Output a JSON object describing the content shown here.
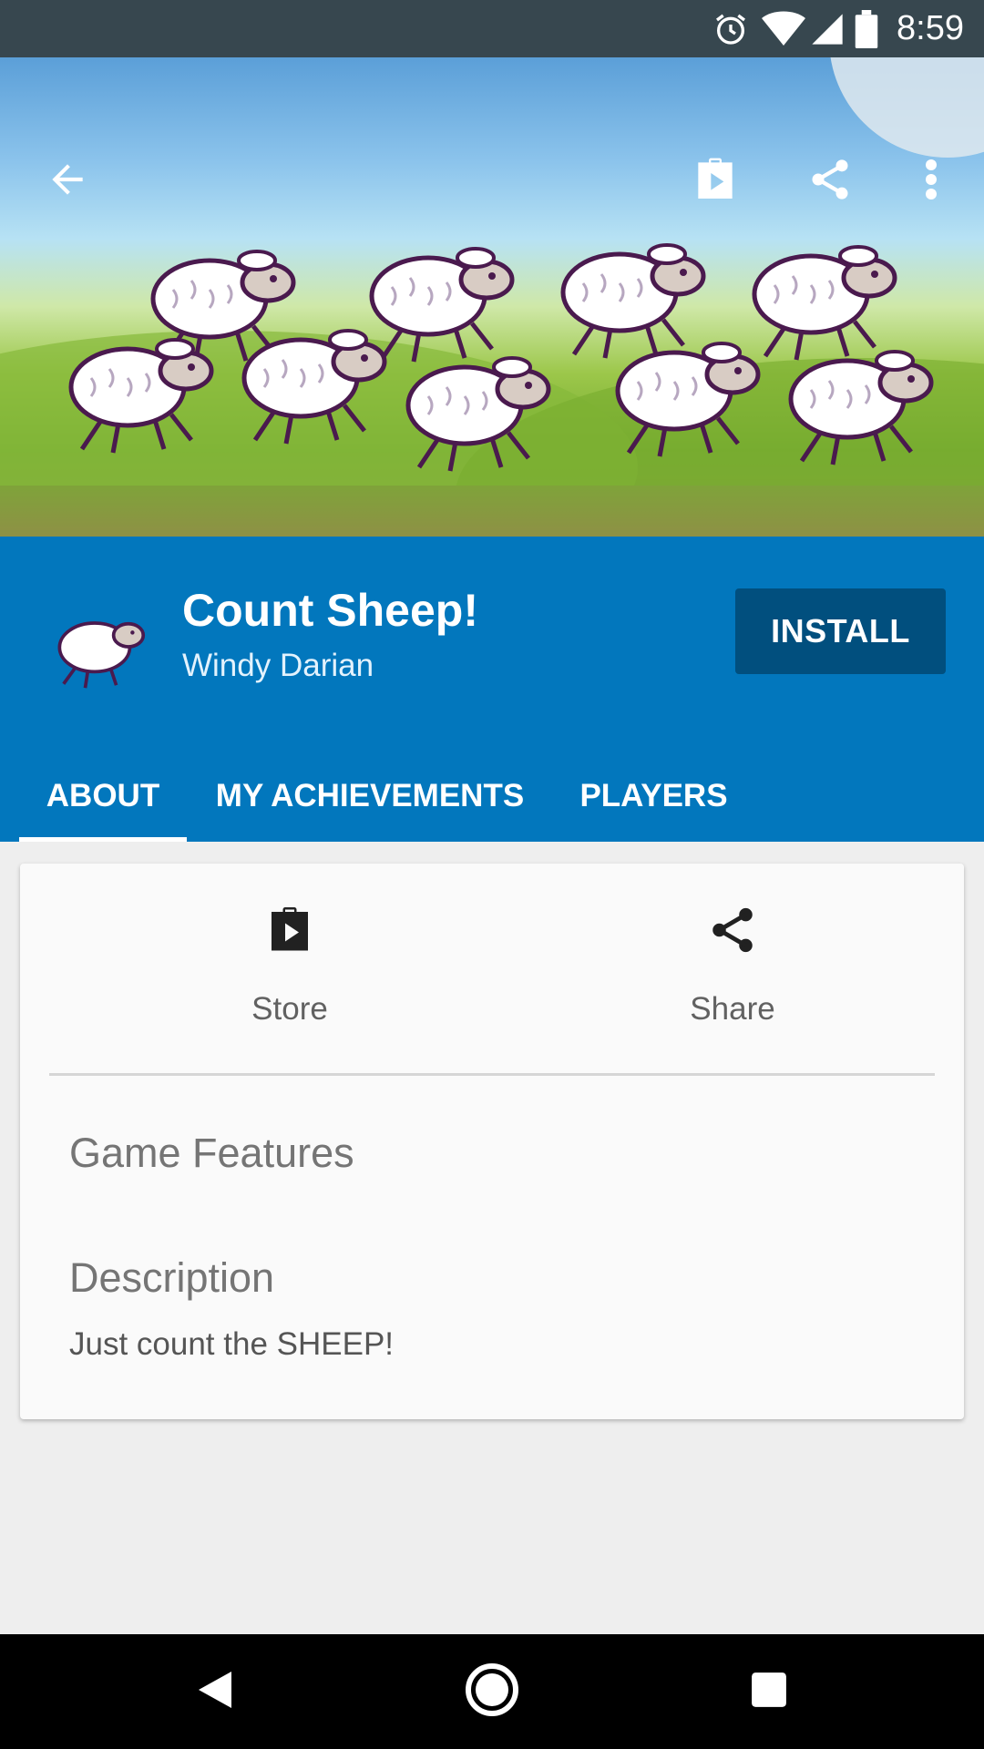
{
  "status_bar": {
    "time": "8:59",
    "icons": [
      "alarm-icon",
      "wifi-icon",
      "cell-signal-icon",
      "battery-icon"
    ]
  },
  "toolbar": {
    "icons": [
      "back-arrow-icon",
      "play-store-icon",
      "share-icon",
      "more-vert-icon"
    ]
  },
  "app": {
    "title": "Count Sheep!",
    "developer": "Windy Darian",
    "install_label": "INSTALL"
  },
  "tabs": [
    {
      "label": "ABOUT",
      "active": true
    },
    {
      "label": "MY ACHIEVEMENTS",
      "active": false
    },
    {
      "label": "PLAYERS",
      "active": false
    }
  ],
  "card": {
    "actions": [
      {
        "label": "Store",
        "icon": "play-store-icon"
      },
      {
        "label": "Share",
        "icon": "share-icon"
      }
    ],
    "features_heading": "Game Features",
    "description_heading": "Description",
    "description_text": "Just count the SHEEP!"
  },
  "nav_bar": {
    "icons": [
      "back-triangle-icon",
      "home-circle-icon",
      "recents-square-icon"
    ]
  },
  "colors": {
    "status_bar": "#37474f",
    "header": "#0277bd",
    "install_button": "#014f7e",
    "page_background": "#eeeeee",
    "card_background": "#fafafa"
  }
}
